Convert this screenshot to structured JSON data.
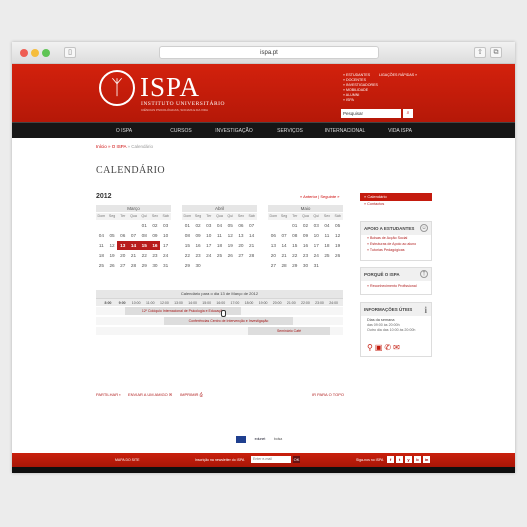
{
  "browser": {
    "url": "ispa.pt"
  },
  "header": {
    "logo_text": "ISPA",
    "logo_sub": "INSTITUTO UNIVERSITÁRIO",
    "logo_sub2": "CIÊNCIAS PSICOLÓGICAS, SOCIAIS E DA VIDA",
    "quick_links": [
      "» ESTUDANTES",
      "» DOCENTES",
      "» INVESTIGADORES",
      "» MOBILIDADE",
      "» ALUMNI",
      "» ISPA"
    ],
    "quick_links_right": "LIGAÇÕES RÁPIDAS »",
    "search_placeholder": "Pesquisar"
  },
  "nav": [
    "O ISPA",
    "CURSOS",
    "INVESTIGAÇÃO",
    "SERVIÇOS",
    "INTERNACIONAL",
    "VIDA ISPA"
  ],
  "breadcrumb": {
    "home": "Início",
    "mid": "» O ISPA",
    "current": "» Calendário"
  },
  "page_title": "CALENDÁRIO",
  "calendar": {
    "year": "2012",
    "prev": "« Anterior",
    "next": "Seguinte »",
    "weekdays": [
      "Dom",
      "Seg",
      "Ter",
      "Qua",
      "Qui",
      "Sex",
      "Sáb"
    ],
    "months": [
      {
        "name": "Março",
        "days": [
          "",
          "",
          "",
          "",
          "01",
          "02",
          "03",
          "04",
          "05",
          "06",
          "07",
          "08",
          "09",
          "10",
          "11",
          "12",
          "13",
          "14",
          "15",
          "16",
          "17",
          "18",
          "19",
          "20",
          "21",
          "22",
          "23",
          "24",
          "25",
          "26",
          "27",
          "28",
          "29",
          "30",
          "31"
        ],
        "highlight": [
          "13",
          "14",
          "15",
          "16"
        ]
      },
      {
        "name": "Abril",
        "days": [
          "01",
          "02",
          "03",
          "04",
          "05",
          "06",
          "07",
          "08",
          "09",
          "10",
          "11",
          "12",
          "13",
          "14",
          "15",
          "16",
          "17",
          "18",
          "19",
          "20",
          "21",
          "22",
          "23",
          "24",
          "25",
          "26",
          "27",
          "28",
          "29",
          "30"
        ],
        "highlight": []
      },
      {
        "name": "Maio",
        "days": [
          "",
          "",
          "01",
          "02",
          "03",
          "04",
          "05",
          "06",
          "07",
          "08",
          "09",
          "10",
          "11",
          "12",
          "13",
          "14",
          "15",
          "16",
          "17",
          "18",
          "19",
          "20",
          "21",
          "22",
          "23",
          "24",
          "25",
          "26",
          "27",
          "28",
          "29",
          "30",
          "31"
        ],
        "highlight": []
      }
    ]
  },
  "timeline": {
    "title": "Calendário para o dia 13 de Março de 2012",
    "hours": [
      "8:00",
      "9:00",
      "10:00",
      "11:00",
      "12:00",
      "13:00",
      "14:00",
      "15:00",
      "16:00",
      "17:00",
      "18:00",
      "19:00",
      "20:00",
      "21:00",
      "22:00",
      "23:00",
      "24:00"
    ],
    "events": [
      "12º Colóquio Internacional de Psicologia e Educação",
      "Conferências Centro de Intervenção e Investigação",
      "Seminário Café"
    ]
  },
  "page_links": {
    "share": "PARTILHAR",
    "send": "ENVIAR A UM AMIGO",
    "print": "IMPRIMIR",
    "top": "IR PARA O TOPO"
  },
  "sidebar": {
    "active": "» Calendário",
    "contacts": "» Contactos",
    "box1": {
      "title": "APOIO A ESTUDANTES",
      "items": [
        "» Bolsas de Acção Social",
        "» Estruturas de Apoio ao aluno",
        "» Tutorias Pedagógicas"
      ]
    },
    "box2": {
      "title": "PORQUÊ O ISPA",
      "items": [
        "» Reconhecimento Profissional"
      ]
    },
    "box3": {
      "title": "INFORMAÇÕES ÚTEIS",
      "l1": "Dias da semana",
      "l2": "das 09:00 às 20:00h",
      "l3": "Outro dia das 10:00 às 20:00h"
    }
  },
  "footer": {
    "map": "MAPA DO SITE",
    "newsletter": "Inscrição na newsletter do ISPA",
    "email_placeholder": "Enter e-mail",
    "go": "OK",
    "follow": "Siga-nos no ISPA",
    "social": [
      "f",
      "t",
      "y",
      "b",
      "in"
    ]
  },
  "partners": [
    "edunet",
    "bolsa"
  ]
}
